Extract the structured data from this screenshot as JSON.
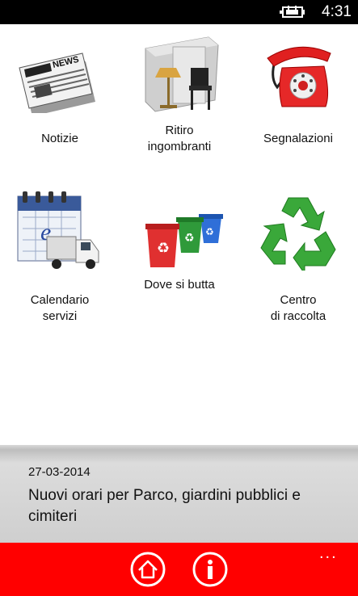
{
  "status_bar": {
    "time": "4:31",
    "battery_icon": "battery-charging-icon"
  },
  "tiles": [
    {
      "label_lines": [
        "Notizie"
      ],
      "icon": "newspaper-icon"
    },
    {
      "label_lines": [
        "Ritiro",
        "ingombranti"
      ],
      "icon": "bulky-waste-icon"
    },
    {
      "label_lines": [
        "Segnalazioni"
      ],
      "icon": "telephone-icon"
    },
    {
      "label_lines": [
        "Calendario",
        "servizi"
      ],
      "icon": "calendar-truck-icon"
    },
    {
      "label_lines": [
        "Dove si butta"
      ],
      "icon": "recycling-bins-icon"
    },
    {
      "label_lines": [
        "Centro",
        "di raccolta"
      ],
      "icon": "recycle-symbol-icon"
    }
  ],
  "news": {
    "date": "27-03-2014",
    "headline": "Nuovi orari per Parco, giardini pubblici e cimiteri"
  },
  "app_bar": {
    "buttons": [
      {
        "icon": "home-icon"
      },
      {
        "icon": "info-icon"
      }
    ],
    "more_label": "..."
  },
  "colors": {
    "app_bar": "#ff0000",
    "status_bar": "#000000",
    "news_band": "#cfcfcf"
  }
}
